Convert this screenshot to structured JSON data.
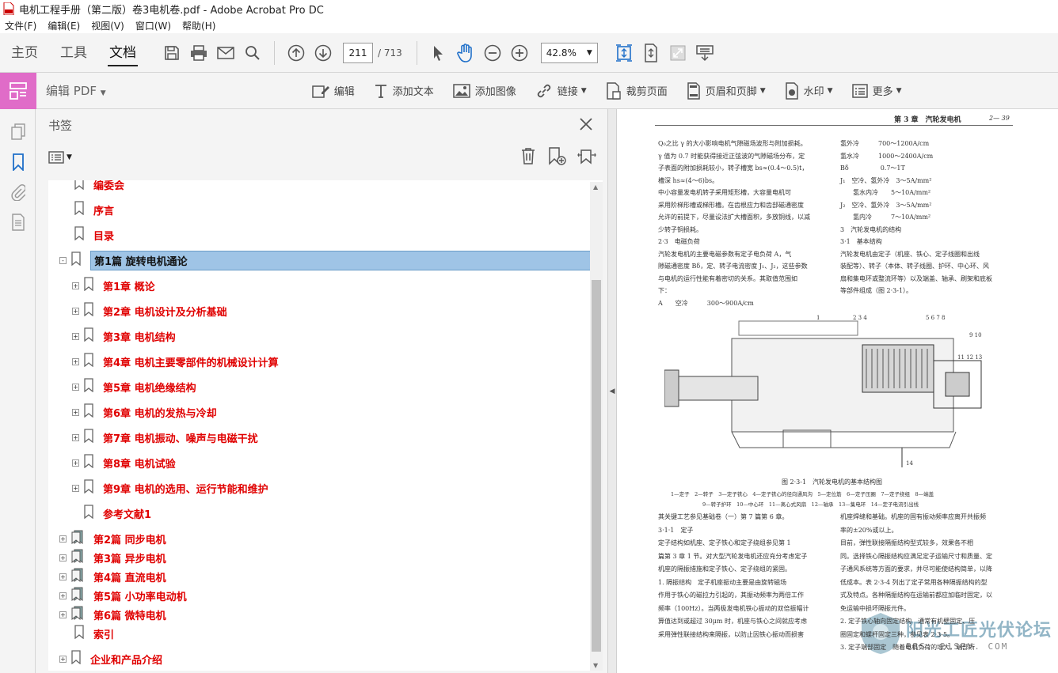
{
  "window": {
    "title": "电机工程手册（第二版）卷3电机卷.pdf - Adobe Acrobat Pro DC"
  },
  "menu": [
    "文件(F)",
    "编辑(E)",
    "视图(V)",
    "窗口(W)",
    "帮助(H)"
  ],
  "nav_tabs": [
    "主页",
    "工具",
    "文档"
  ],
  "page_nav": {
    "current": "211",
    "total": "/ 713"
  },
  "zoom": "42.8%",
  "edit_toolbar": {
    "mode_label": "编辑 PDF",
    "tools": [
      "编辑",
      "添加文本",
      "添加图像",
      "链接",
      "裁剪页面",
      "页眉和页脚",
      "水印",
      "更多"
    ]
  },
  "bookmarks": {
    "title": "书签",
    "items": [
      {
        "label": "编委会"
      },
      {
        "label": "序言"
      },
      {
        "label": "目录"
      },
      {
        "label": "第1篇 旋转电机通论"
      },
      {
        "label": "第1章 概论"
      },
      {
        "label": "第2章 电机设计及分析基础"
      },
      {
        "label": "第3章 电机结构"
      },
      {
        "label": "第4章 电机主要零部件的机械设计计算"
      },
      {
        "label": "第5章 电机绝缘结构"
      },
      {
        "label": "第6章 电机的发热与冷却"
      },
      {
        "label": "第7章 电机振动、噪声与电磁干扰"
      },
      {
        "label": "第8章 电机试验"
      },
      {
        "label": "第9章 电机的选用、运行节能和维护"
      },
      {
        "label": "参考文献1"
      },
      {
        "label": "第2篇 同步电机"
      },
      {
        "label": "第3篇 异步电机"
      },
      {
        "label": "第4篇 直流电机"
      },
      {
        "label": "第5篇 小功率电动机"
      },
      {
        "label": "第6篇 微特电机"
      },
      {
        "label": "索引"
      },
      {
        "label": "企业和产品介绍"
      }
    ]
  },
  "page": {
    "header_chapter": "第 3 章　汽轮发电机",
    "header_page": "2— 39",
    "left_col": [
      "Q₀之比 γ 的大小影响电机气隙磁场波形与附加损耗。",
      "γ 值为 0.7 时能获得接近正弦波的气隙磁场分布，定",
      "子表面的附加损耗较小，转子槽宽 bs≈(0.4～0.5)t，",
      "槽深 hs≈(4～6)bs。",
      "中小容量发电机转子采用矩形槽，大容量电机可",
      "采用阶梯形槽或梯形槽。在齿根应力和齿部磁通密度",
      "允许的前提下，尽量设法扩大槽面积，多放铜线，以减",
      "少转子铜损耗。",
      "2·3　电磁负荷",
      "汽轮发电机的主要电磁参数有定子电负荷 A，气",
      "隙磁通密度 Bδ，定、转子电流密度 J₁、J₂，这些参数",
      "与电机的运行性能有着密切的关系。其取值范围如",
      "下：",
      "A　　空冷　　　300～900A/cm"
    ],
    "right_col": [
      "氢外冷　　　700～1200A/cm",
      "氢水冷　　　1000～2400A/cm",
      "Bδ　　　　　0.7～1T",
      "J₁　空冷、氢外冷　3～5A/mm²",
      "　　氢水内冷　　5～10A/mm²",
      "J₂　空冷、氢外冷　3～5A/mm²",
      "　　氢内冷　　　7～10A/mm²",
      "3　汽轮发电机的结构",
      "3·1　基本结构",
      "汽轮发电机由定子（机座、铁心、定子线圈和出线",
      "装配等）、转子（本体、转子线圈、护环、中心环、风",
      "扇和集电环或整流环等）以及端盖、轴承、刷架和底板",
      "等部件组成（图 2·3-1）。"
    ],
    "figure_caption": "图 2·3-1　汽轮发电机的基本结构图",
    "figure_legend_1": "1—定子　2—转子　3—定子铁心　4—定子铁心的径向通风沟　5—定位筋　6—定子压圈　7—定子绕组　8—端盖",
    "figure_legend_2": "9—转子护环　10—中心环　11—离心式风扇　12—轴承　13—集电环　14—定子电流引出线",
    "lower_left": [
      "其关键工艺参见基础卷（一）第 7 篇第 6 章。",
      "3·1·1　定子",
      "定子结构如机座、定子铁心和定子绕组参见第 1",
      "篇第 3 章 1 节。对大型汽轮发电机还应充分考虑定子",
      "机座的隔振措施和定子铁心、定子绕组的紧固。",
      "1. 隔振结构　定子机座振动主要是由旋转磁场",
      "作用于铁心的磁拉力引起的，其振动频率为两倍工作",
      "频率（100Hz）。当两极发电机铁心振动的双倍振幅计",
      "算值达到或超过 30μm 时，机座与铁心之间就应考虑",
      "采用弹性联接结构来隔振，以防止因铁心振动而损害"
    ],
    "lower_right": [
      "机座焊缝和基础。机座的固有振动频率应离开共振频",
      "率的±20%或以上。",
      "目前，弹性联接隔振结构型式较多，效果各不相",
      "同。选择铁心隔振结构应满足定子运输尺寸和质量、定",
      "子通风系统等方面的要求，并尽可能使结构简单，以降",
      "低成本。表 2·3-4 列出了定子常用各种隔振结构的型",
      "式及特点。各种隔振结构在运输前都应加临时固定，以",
      "免运输中损坏隔振元件。",
      "2. 定子铁心轴向固定结构　通常有机壁固定、压",
      "圈固定和螺杆固定三种，参见表 2·3-5。",
      "3. 定子端部固定　随着电机负荷的增大，端部所"
    ],
    "watermark_text": "阳光工匠光伏论坛",
    "watermark_url": "BBS. 21SPV. COM"
  },
  "colors": {
    "bookmark_red": "#e00000",
    "edit_mode_pink": "#e06cc8",
    "selection_blue": "#9fc4e6"
  }
}
